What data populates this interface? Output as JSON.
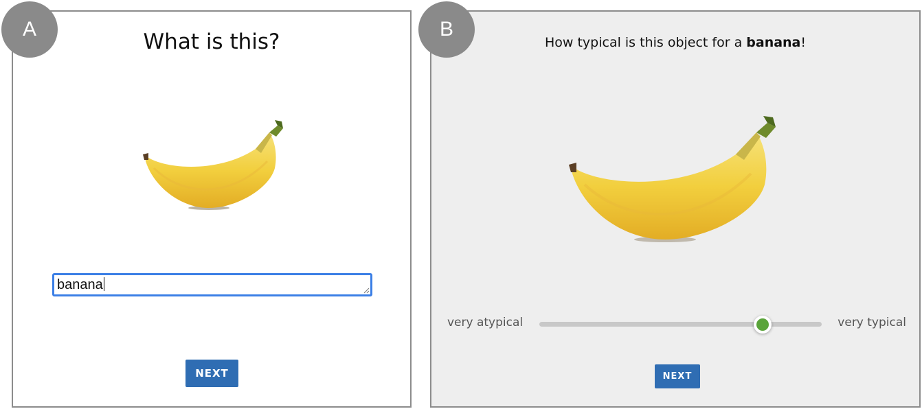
{
  "panel_a": {
    "badge": "A",
    "title": "What is this?",
    "answer_value": "banana",
    "next_label": "NEXT"
  },
  "panel_b": {
    "badge": "B",
    "title_prefix": "How typical is this object for a ",
    "title_bold": "banana",
    "title_suffix": "!",
    "scale_left_label": "very atypical",
    "scale_right_label": "very typical",
    "slider_value_fraction": 0.79,
    "next_label": "NEXT"
  },
  "colors": {
    "button_blue": "#2f6db3",
    "slider_thumb_green": "#5aa43a",
    "focus_border_blue": "#3b7fe6",
    "badge_gray": "#8a8a8a"
  },
  "icons": {
    "image": "banana-image"
  }
}
